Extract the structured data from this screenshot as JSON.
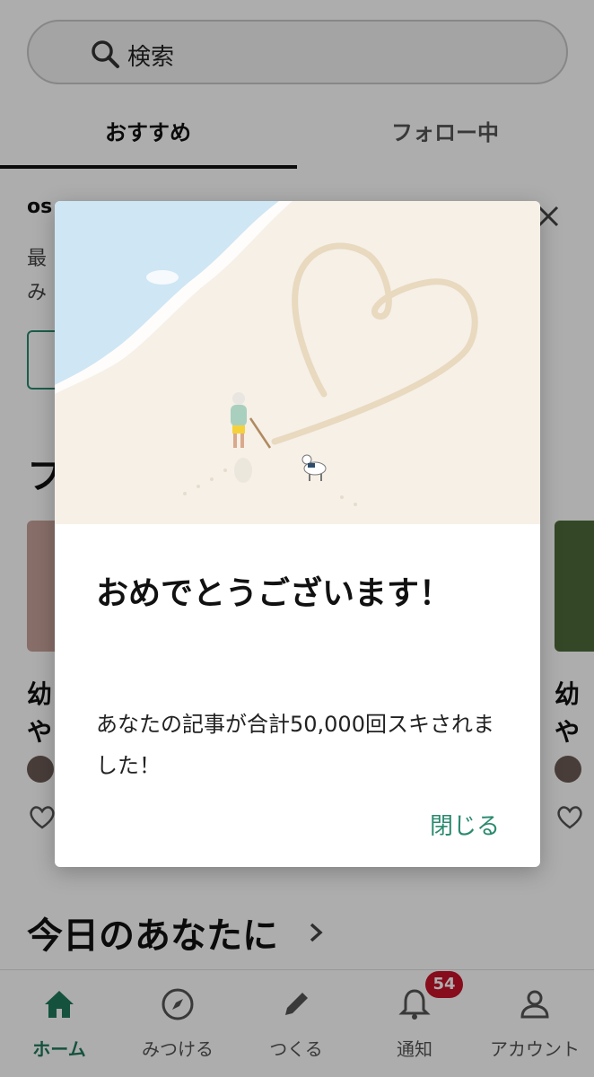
{
  "search": {
    "placeholder": "検索"
  },
  "tabs": [
    {
      "label": "おすすめ",
      "active": true
    },
    {
      "label": "フォロー中",
      "active": false
    }
  ],
  "notice": {
    "title": "os",
    "body_line1": "最",
    "body_line2": "み"
  },
  "section": {
    "title": "フ"
  },
  "cards": [
    {
      "title_line1": "幼",
      "title_line2": "や"
    },
    {
      "title_line1": "幼",
      "title_line2": "や"
    }
  ],
  "today": {
    "title": "今日のあなたに"
  },
  "bottom_nav": [
    {
      "label": "ホーム",
      "icon": "home-icon",
      "active": true
    },
    {
      "label": "みつける",
      "icon": "compass-icon",
      "active": false
    },
    {
      "label": "つくる",
      "icon": "pencil-icon",
      "active": false
    },
    {
      "label": "通知",
      "icon": "bell-icon",
      "active": false
    },
    {
      "label": "アカウント",
      "icon": "person-icon",
      "active": false
    }
  ],
  "notification_badge": "54",
  "modal": {
    "title": "おめでとうございます！",
    "body": "あなたの記事が合計50,000回スキされました！",
    "close_label": "閉じる"
  },
  "colors": {
    "accent": "#1f7a5c",
    "badge": "#c8122a",
    "modal_close": "#2a8a6e",
    "sand": "#f5efe6",
    "water": "#cfe6f4"
  }
}
